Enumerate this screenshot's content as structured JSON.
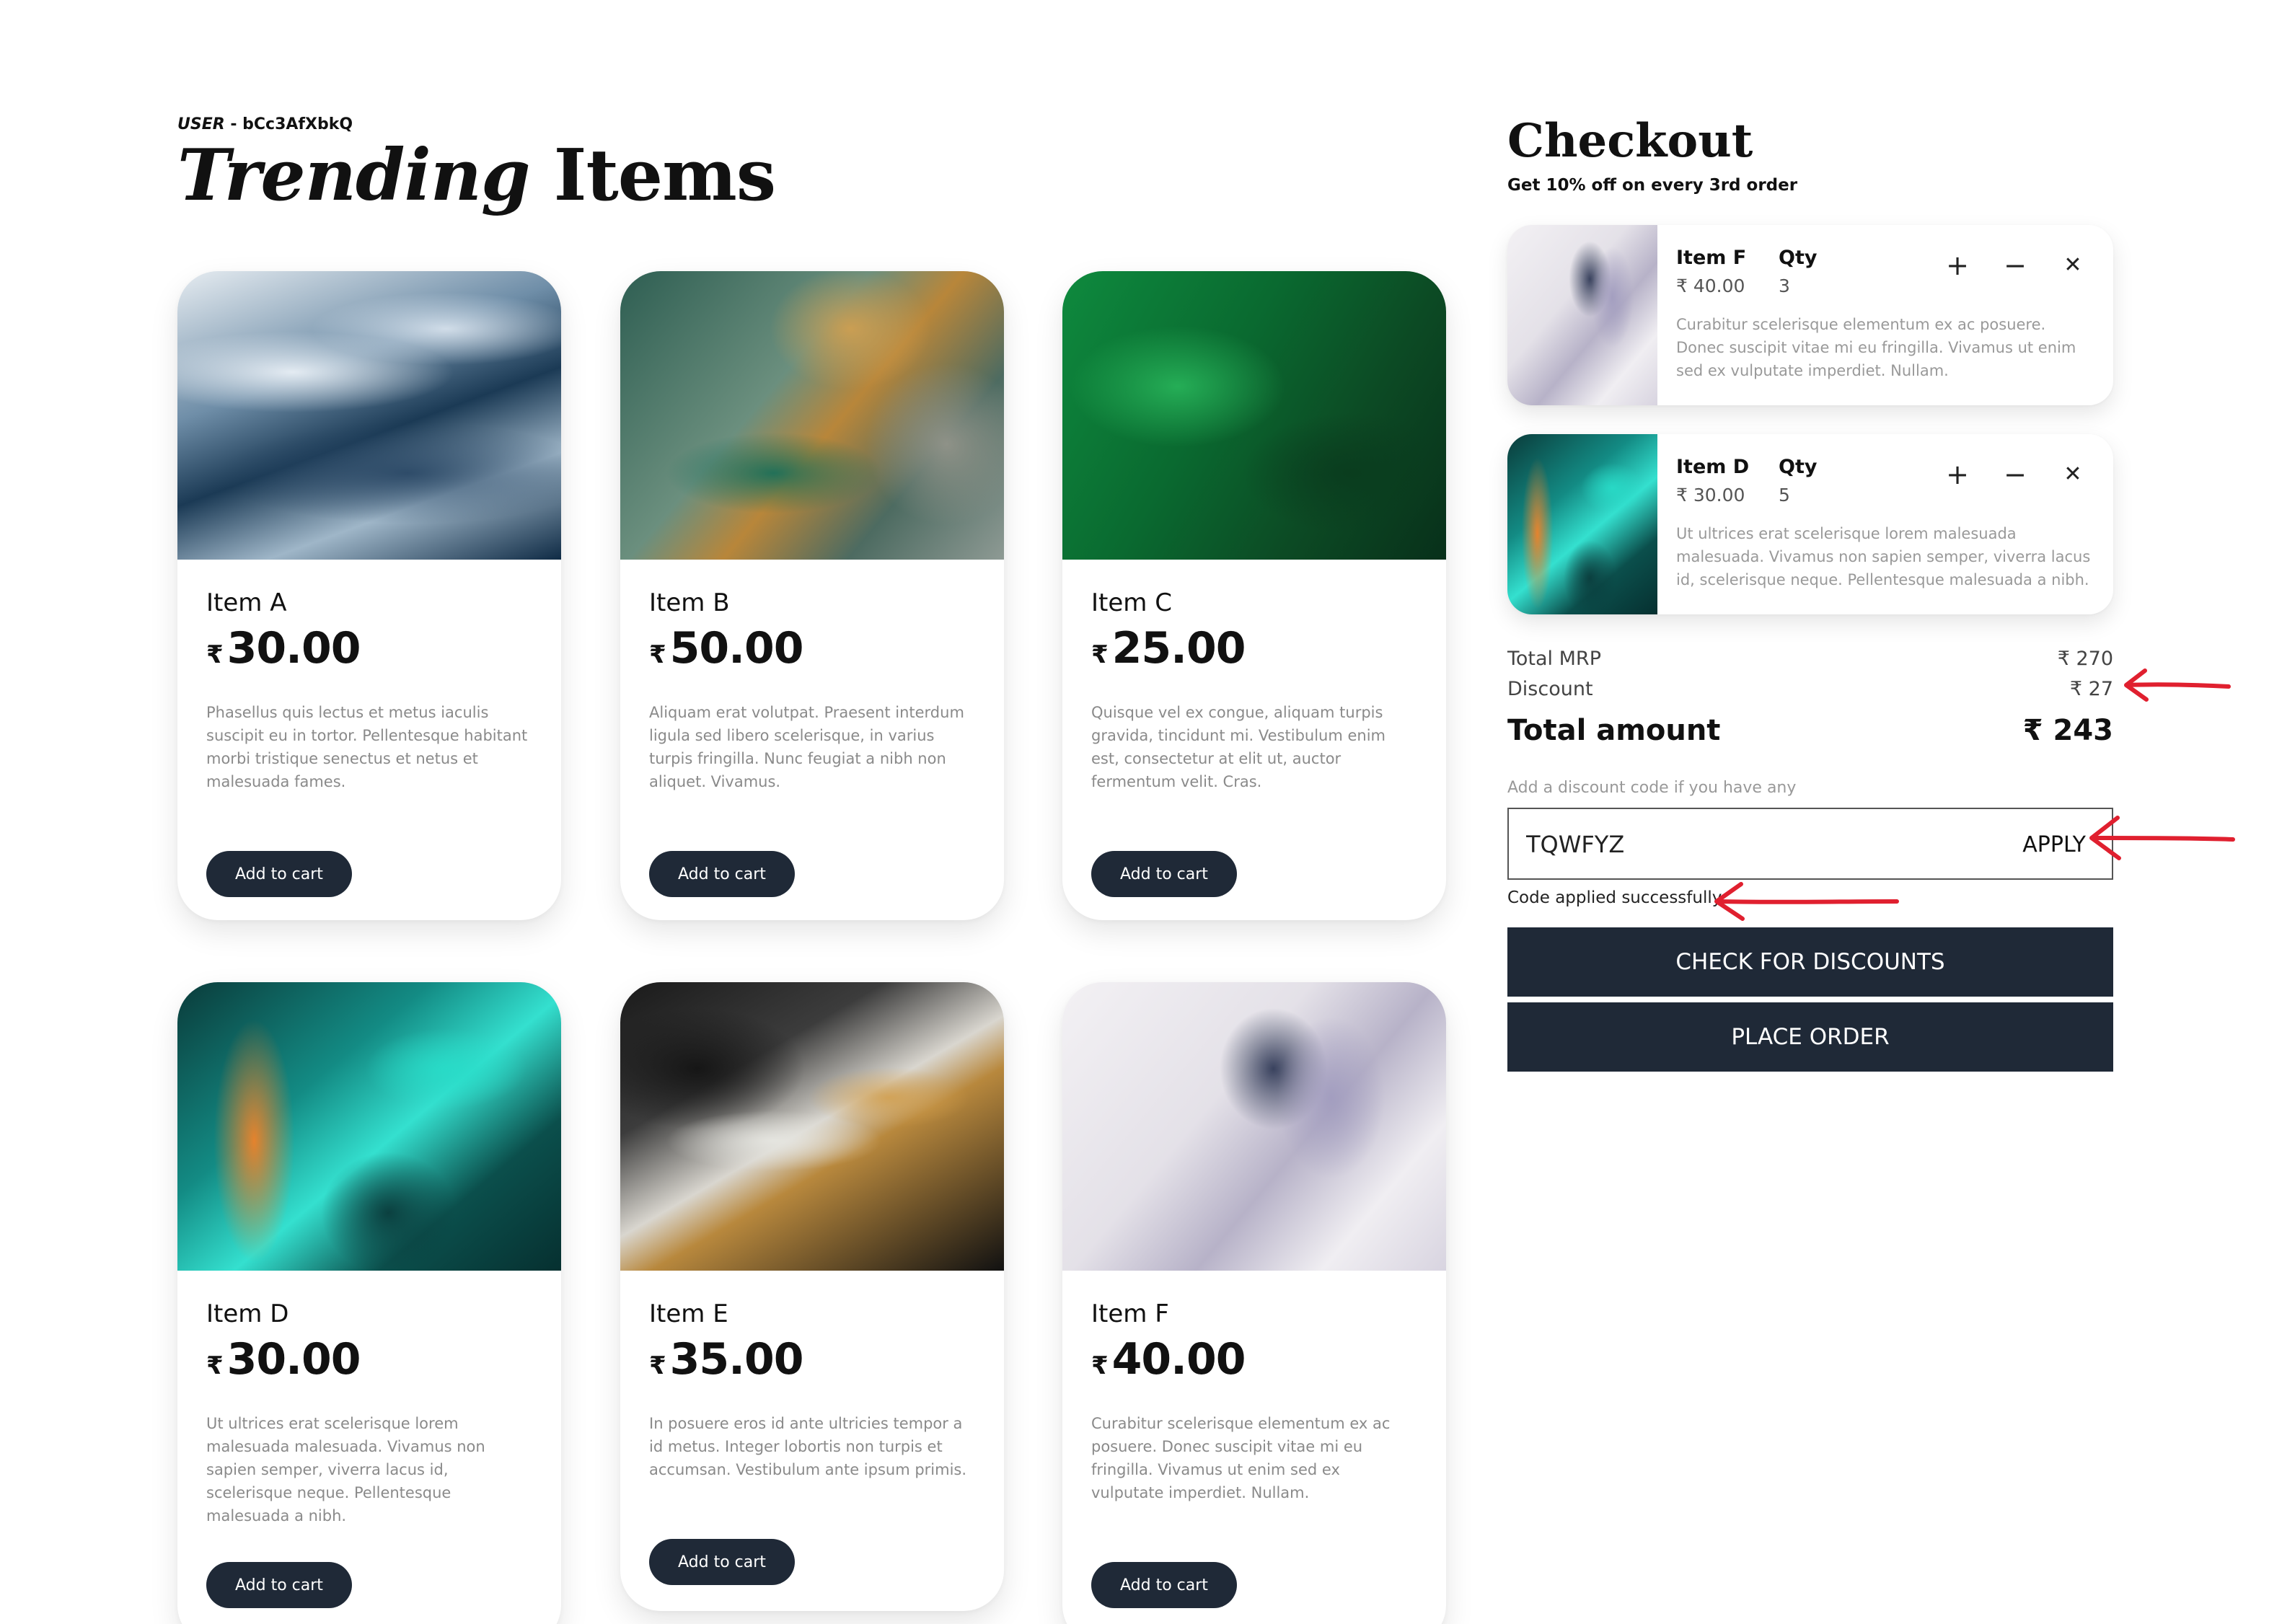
{
  "user": {
    "key": "USER",
    "sep": " - ",
    "id": "bCc3AfXbkQ"
  },
  "heading": {
    "italic": "Trending",
    "rest": " Items"
  },
  "currency_symbol": "₹",
  "add_to_cart_label": "Add to cart",
  "products": [
    {
      "name": "Item A",
      "price": "30.00",
      "texture": "blue-white-marble",
      "desc": "Phasellus quis lectus et metus iaculis suscipit eu in tortor. Pellentesque habitant morbi tristique senectus et netus et malesuada fames."
    },
    {
      "name": "Item B",
      "price": "50.00",
      "texture": "green-gold-marble",
      "desc": "Aliquam erat volutpat. Praesent interdum ligula sed libero scelerisque, in varius turpis fringilla. Nunc feugiat a nibh non aliquet. Vivamus."
    },
    {
      "name": "Item C",
      "price": "25.00",
      "texture": "emerald-marble",
      "desc": "Quisque vel ex congue, aliquam turpis gravida, tincidunt mi. Vestibulum enim est, consectetur at elit ut, auctor fermentum velit. Cras."
    },
    {
      "name": "Item D",
      "price": "30.00",
      "texture": "teal-orange-marble",
      "desc": "Ut ultrices erat scelerisque lorem malesuada malesuada. Vivamus non sapien semper, viverra lacus id, scelerisque neque. Pellentesque malesuada a nibh."
    },
    {
      "name": "Item E",
      "price": "35.00",
      "texture": "black-gold-marble",
      "desc": "In posuere eros id ante ultricies tempor a id metus. Integer lobortis non turpis et accumsan. Vestibulum ante ipsum primis."
    },
    {
      "name": "Item F",
      "price": "40.00",
      "texture": "white-lavender-marble",
      "desc": "Curabitur scelerisque elementum ex ac posuere. Donec suscipit vitae mi eu fringilla. Vivamus ut enim sed ex vulputate imperdiet. Nullam."
    }
  ],
  "checkout": {
    "title": "Checkout",
    "subtitle": "Get 10% off on every 3rd order",
    "qty_label": "Qty",
    "controls": {
      "plus": "+",
      "minus": "−",
      "remove": "✕"
    },
    "cart": [
      {
        "name": "Item F",
        "price": "₹ 40.00",
        "qty": "3",
        "texture": "white-lavender-marble",
        "desc": "Curabitur scelerisque elementum ex ac posuere. Donec suscipit vitae mi eu fringilla. Vivamus ut enim sed ex vulputate imperdiet. Nullam."
      },
      {
        "name": "Item D",
        "price": "₹ 30.00",
        "qty": "5",
        "texture": "teal-orange-marble",
        "desc": "Ut ultrices erat scelerisque lorem malesuada malesuada. Vivamus non sapien semper, viverra lacus id, scelerisque neque. Pellentesque malesuada a nibh."
      }
    ],
    "totals": {
      "mrp_label": "Total MRP",
      "mrp_value": "₹ 270",
      "discount_label": "Discount",
      "discount_value": "₹ 27",
      "total_label": "Total amount",
      "total_value": "₹ 243"
    },
    "discount_code": {
      "label": "Add a discount code if you have any",
      "value": "TQWFYZ",
      "apply_label": "APPLY",
      "message": "Code applied successfully."
    },
    "check_discounts_label": "CHECK FOR DISCOUNTS",
    "place_order_label": "PLACE ORDER"
  },
  "colors": {
    "button_dark": "#1f2937",
    "annotation_red": "#e0202f"
  }
}
